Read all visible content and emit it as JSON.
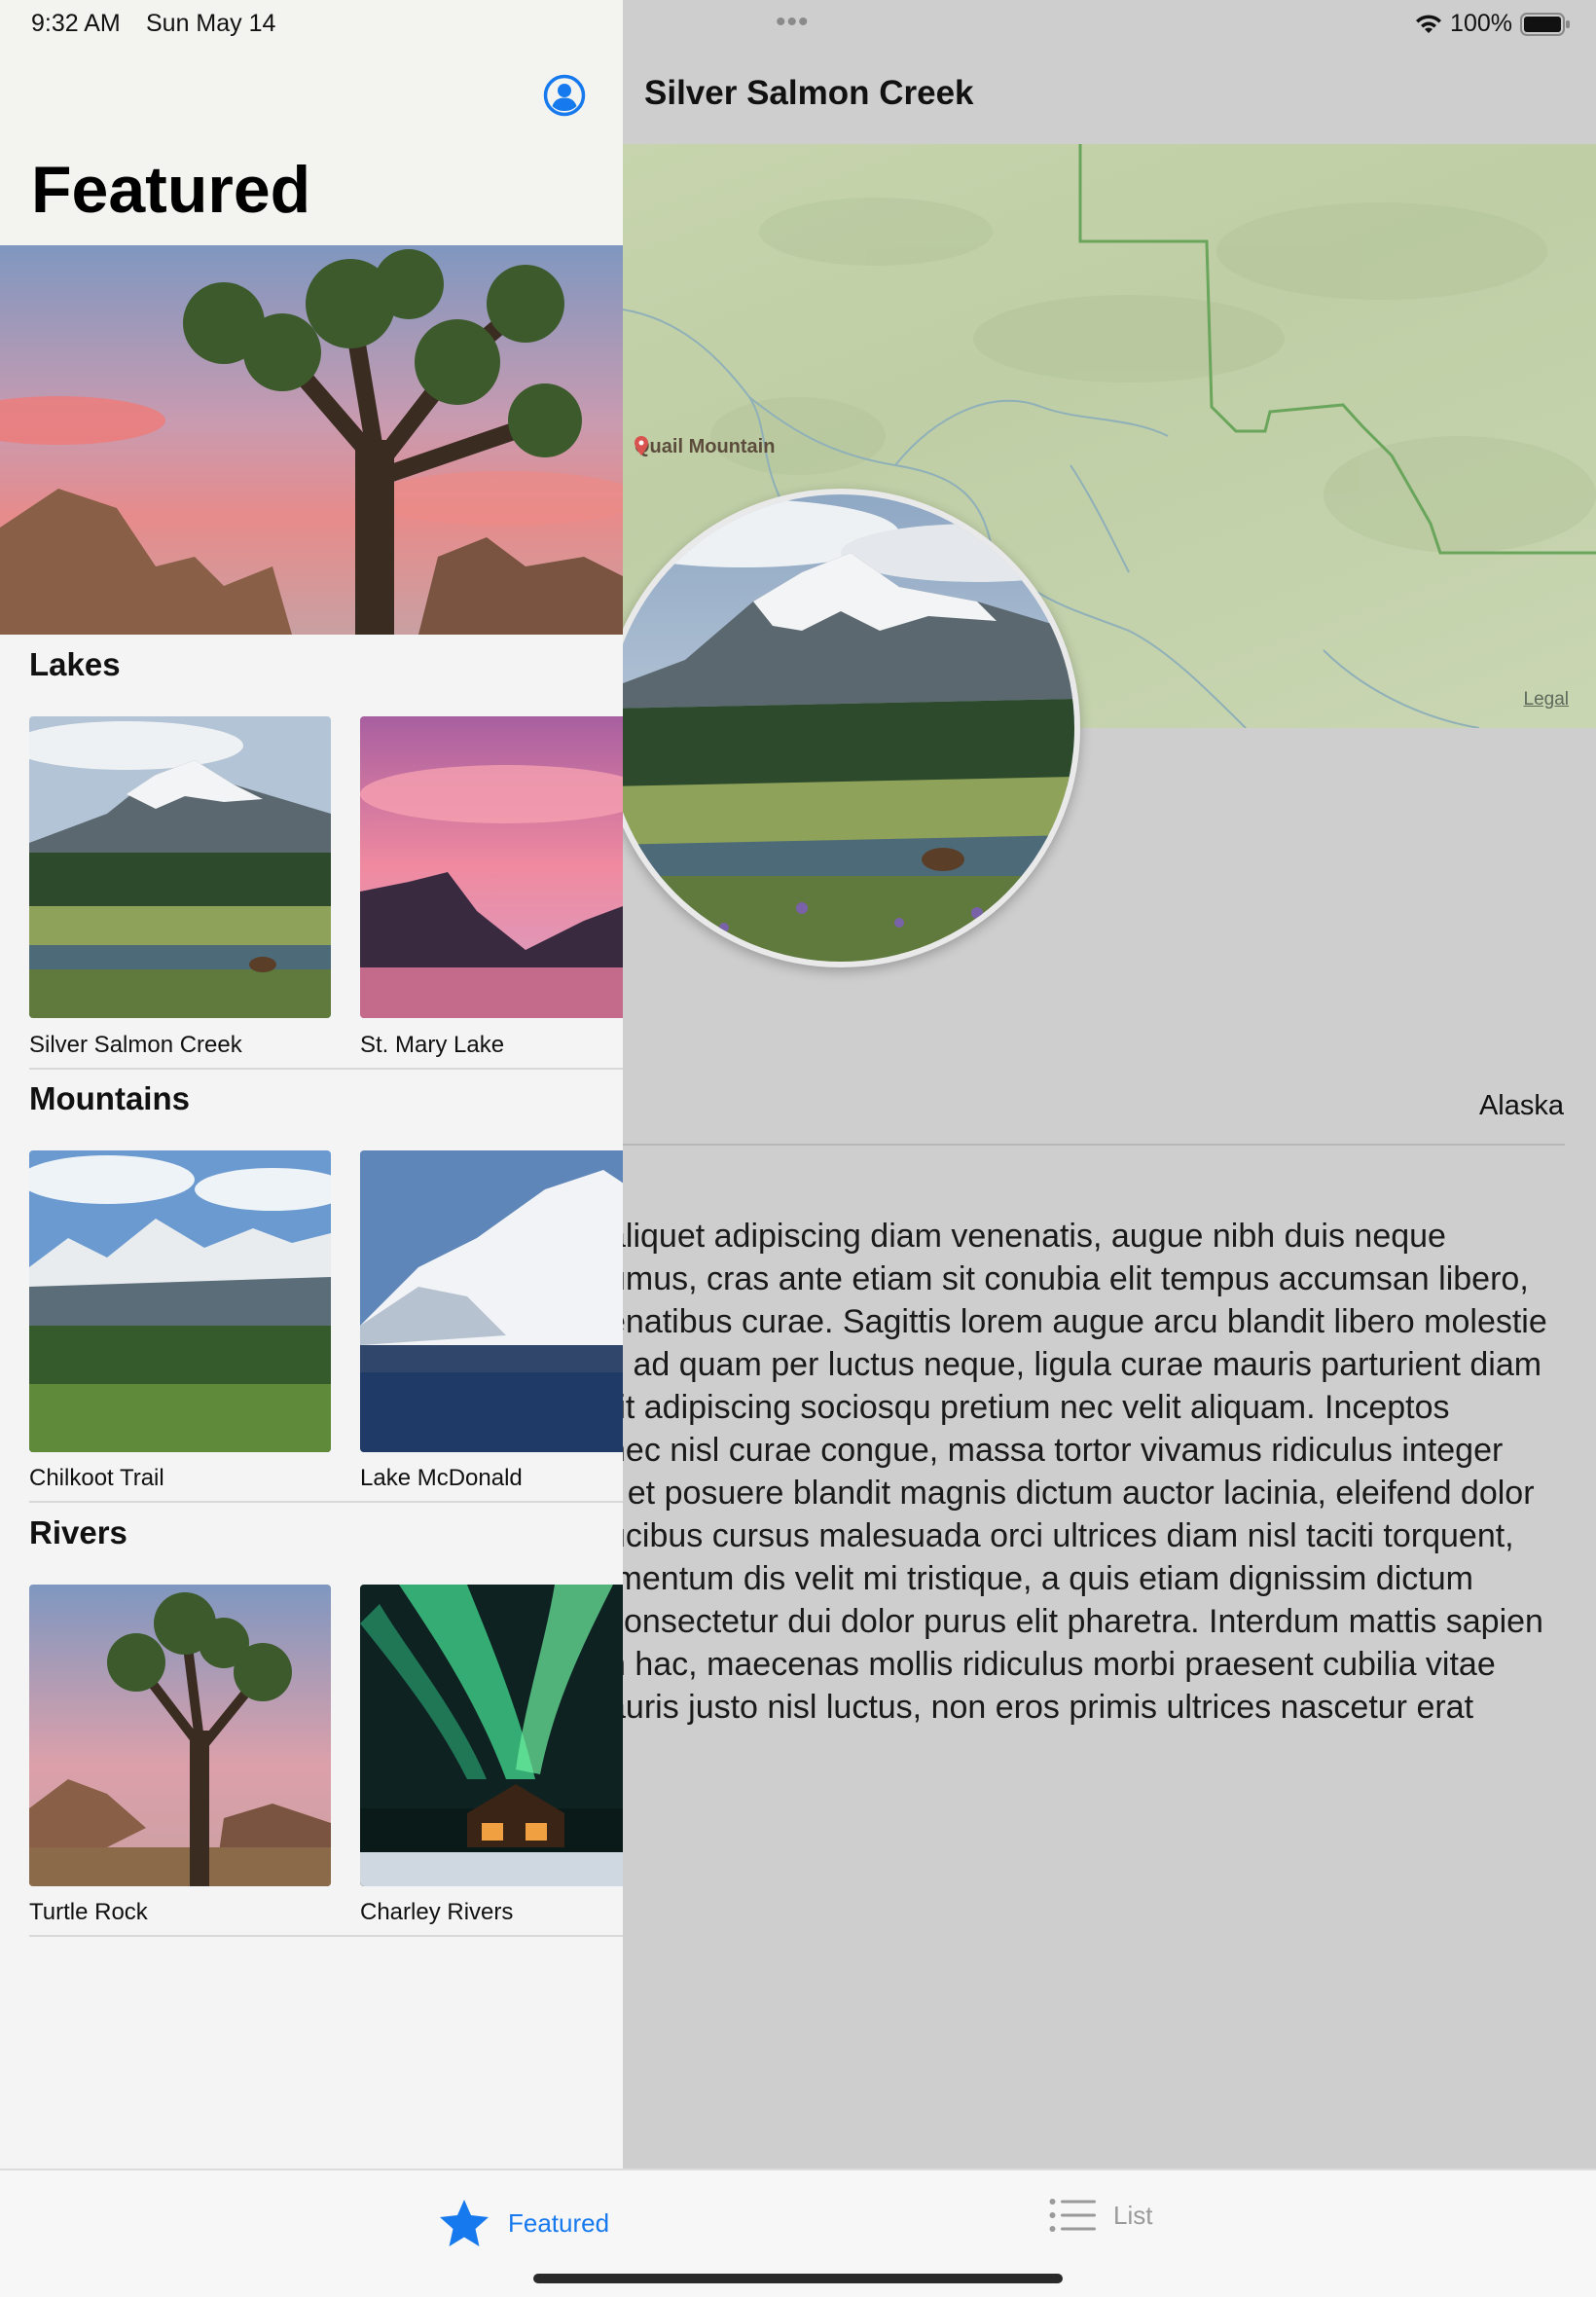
{
  "status_bar": {
    "time": "9:32 AM",
    "date": "Sun May 14",
    "battery": "100%"
  },
  "sidebar": {
    "title": "Featured",
    "sections": [
      {
        "title": "Lakes",
        "items": [
          {
            "name": "Silver Salmon Creek"
          },
          {
            "name": "St. Mary Lake"
          }
        ]
      },
      {
        "title": "Mountains",
        "items": [
          {
            "name": "Chilkoot Trail"
          },
          {
            "name": "Lake McDonald"
          }
        ]
      },
      {
        "title": "Rivers",
        "items": [
          {
            "name": "Turtle Rock"
          },
          {
            "name": "Charley Rivers"
          }
        ]
      }
    ]
  },
  "detail": {
    "title": "Silver Salmon Creek",
    "map_label": "Quail Mountain",
    "map_legal": "Legal",
    "state": "Alaska",
    "description_lines": [
      "aliquet adipiscing diam venenatis, augue nibh duis neque",
      "umus, cras ante etiam sit conubia elit tempus accumsan libero,",
      "enatibus curae. Sagittis lorem augue arcu blandit libero molestie",
      "s ad quam per luctus neque, ligula curae mauris parturient diam",
      "rit adipiscing sociosqu pretium nec velit aliquam. Inceptos",
      "nec nisl curae congue, massa tortor vivamus ridiculus integer",
      "r et posuere blandit magnis dictum auctor lacinia, eleifend dolor",
      "ucibus cursus malesuada orci ultrices diam nisl taciti torquent,",
      "imentum dis velit mi tristique, a quis etiam dignissim dictum",
      "consectetur dui dolor purus elit pharetra. Interdum mattis sapien",
      "n hac, maecenas mollis ridiculus morbi praesent cubilia vitae",
      "auris justo nisl luctus, non eros primis ultrices nascetur erat"
    ]
  },
  "tabbar": {
    "featured_label": "Featured",
    "list_label": "List"
  },
  "colors": {
    "accent": "#1679ee",
    "map_green": "#c7d4ad",
    "detail_bg": "#cecece"
  }
}
